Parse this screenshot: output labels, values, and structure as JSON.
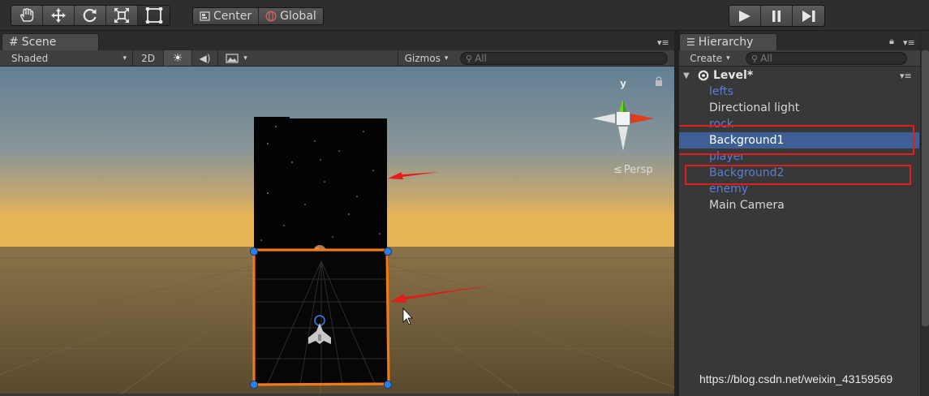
{
  "toolbar": {
    "tools": [
      {
        "name": "hand-tool",
        "icon": "hand-icon"
      },
      {
        "name": "move-tool",
        "icon": "move-arrows-icon"
      },
      {
        "name": "rotate-tool",
        "icon": "rotate-icon"
      },
      {
        "name": "scale-tool",
        "icon": "scale-icon"
      },
      {
        "name": "rect-tool",
        "icon": "rect-transform-icon",
        "active": true
      }
    ],
    "pivot_label": "Center",
    "space_label": "Global",
    "play_controls": [
      "play-icon",
      "pause-icon",
      "step-icon"
    ]
  },
  "scene": {
    "tab_label": "Scene",
    "shading_mode": "Shaded",
    "mode_2d_label": "2D",
    "gizmos_label": "Gizmos",
    "search_placeholder": "All",
    "projection_label": "Persp",
    "gizmo_axis_label": "y"
  },
  "hierarchy": {
    "tab_label": "Hierarchy",
    "create_label": "Create",
    "search_placeholder": "All",
    "scene_name": "Level*",
    "items": [
      {
        "label": "lefts",
        "kind": "prefab",
        "selected": false
      },
      {
        "label": "Directional light",
        "kind": "normal",
        "selected": false
      },
      {
        "label": "rock",
        "kind": "prefab",
        "selected": false
      },
      {
        "label": "Background1",
        "kind": "prefab",
        "selected": true
      },
      {
        "label": "player",
        "kind": "prefab",
        "selected": false
      },
      {
        "label": "Background2",
        "kind": "prefab",
        "selected": false
      },
      {
        "label": "enemy",
        "kind": "prefab",
        "selected": false
      },
      {
        "label": "Main Camera",
        "kind": "normal",
        "selected": false
      }
    ]
  },
  "watermark": "https://blog.csdn.net/weixin_43159569",
  "colors": {
    "selection": "#3e5f96",
    "prefab_text": "#5a7cd4",
    "annotation_red": "#e11d1d",
    "rect_handle_orange": "#f07a1a",
    "handle_blue": "#2f7fe0"
  }
}
